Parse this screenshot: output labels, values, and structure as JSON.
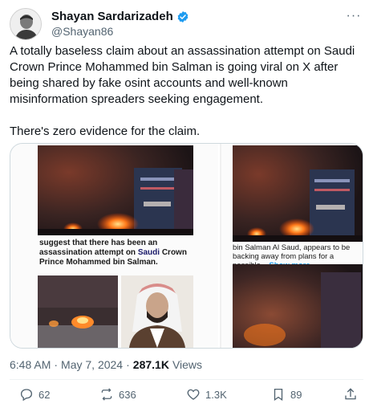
{
  "author": {
    "display_name": "Shayan Sardarizadeh",
    "handle": "@Shayan86",
    "verified": true,
    "avatar_icon": "avatar-photo-icon"
  },
  "more_icon": "more-dots-icon",
  "tweet": {
    "paragraph1": "A totally baseless claim about an assassination attempt on Saudi Crown Prince Mohammed bin Salman is going viral on X after being shared by fake osint accounts and well-known misinformation spreaders seeking engagement.",
    "paragraph2": "There's zero evidence for the claim."
  },
  "media": {
    "left_caption_part1": "suggest that there has been an assassination attempt on ",
    "left_caption_bold": "Saudi",
    "left_caption_part2": " Crown Prince Mohammed bin Salman.",
    "right_caption": "bin Salman Al Saud, appears to be backing away from plans for a possible...",
    "right_show_more": "Show more"
  },
  "meta": {
    "time": "6:48 AM",
    "separator": "·",
    "date": "May 7, 2024",
    "views_count": "287.1K",
    "views_label": "Views"
  },
  "actions": {
    "replies": "62",
    "reposts": "636",
    "likes": "1.3K",
    "bookmarks": "89"
  },
  "colors": {
    "accent": "#1d9bf0",
    "text": "#0f1419",
    "secondary": "#536471"
  }
}
